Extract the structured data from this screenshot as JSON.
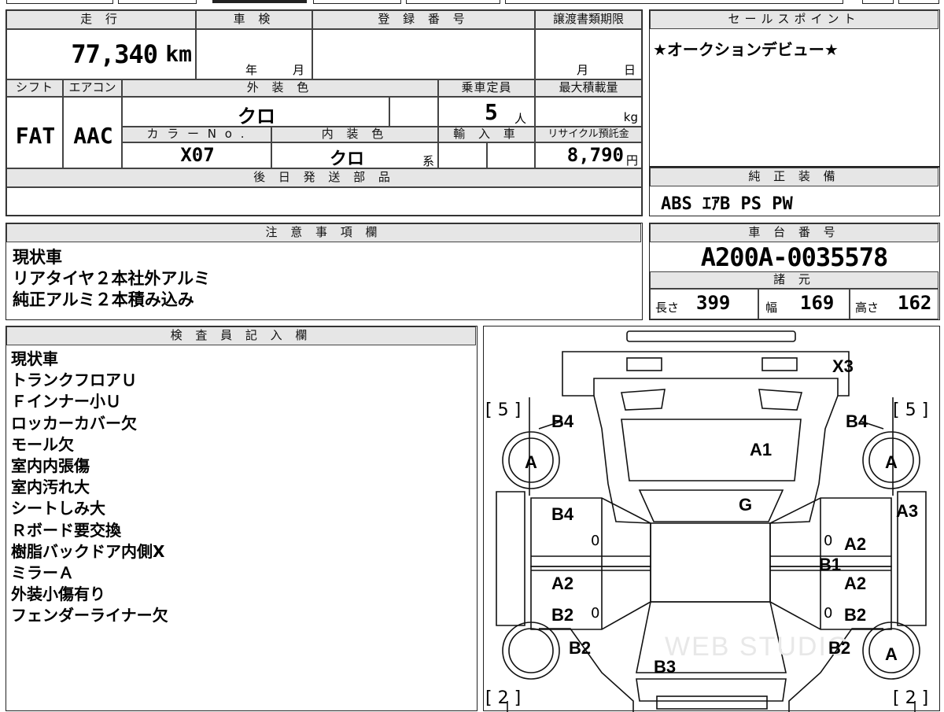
{
  "main": {
    "headers": {
      "mileage": "走 行",
      "inspection": "車 検",
      "registration": "登 録 番 号",
      "transfer_deadline": "譲渡書類期限",
      "shift": "シフト",
      "aircon": "エアコン",
      "exterior_color": "外 装 色",
      "capacity": "乗車定員",
      "max_load": "最大積載量",
      "color_no": "カ ラ ー N o .",
      "interior_color": "内 装 色",
      "import": "輸 入 車",
      "recycle": "リサイクル預託金",
      "later_parts": "後 日 発 送 部 品"
    },
    "mileage_value": "77,340",
    "mileage_unit": "km",
    "inspection_year_label": "年",
    "inspection_month_label": "月",
    "deadline_month_label": "月",
    "deadline_day_label": "日",
    "shift_value": "FAT",
    "aircon_value": "AAC",
    "exterior_color_value": "クロ",
    "capacity_value": "5",
    "capacity_unit": "人",
    "max_load_unit": "kg",
    "color_no_value": "X07",
    "interior_color_value": "クロ",
    "interior_suffix": "系",
    "recycle_value": "8,790",
    "recycle_unit": "円"
  },
  "sales": {
    "header": "セールスポイント",
    "text": "★オークションデビュー★"
  },
  "equipment": {
    "header": "純 正 装 備",
    "text": "ABS ｴｱB PS PW"
  },
  "notes": {
    "header": "注 意 事 項 欄",
    "lines": [
      "現状車",
      "リアタイヤ２本社外アルミ",
      "純正アルミ２本積み込み"
    ]
  },
  "chassis": {
    "header": "車 台 番 号",
    "value": "A200A-0035578",
    "spec_header": "諸 元",
    "length_label": "長さ",
    "length_value": "399",
    "width_label": "幅",
    "width_value": "169",
    "height_label": "高さ",
    "height_value": "162"
  },
  "inspector": {
    "header": "検 査 員 記 入 欄",
    "lines": [
      "現状車",
      "トランクフロアＵ",
      "Ｆインナー小Ｕ",
      "ロッカーカバー欠",
      "モール欠",
      "室内内張傷",
      "室内汚れ大",
      "シートしみ大",
      "Ｒボード要交換",
      "樹脂バックドア内側X",
      "ミラーＡ",
      "外装小傷有り",
      "フェンダーライナー欠"
    ]
  },
  "diagram": {
    "watermark": "WEB STUDIO",
    "tire_tread_front_left": "[ 5 ]",
    "tire_tread_front_right": "[ 5 ]",
    "tire_tread_rear_left": "[ 2 ]",
    "tire_tread_rear_right": "[ 2 ]",
    "marks": {
      "x3": "X3",
      "b4_left": "B4",
      "b4_right": "B4",
      "a_front_left": "A",
      "a_front_right": "A",
      "a1": "A1",
      "g": "G",
      "b4_door": "B4",
      "a3": "A3",
      "a2_right_front": "A2",
      "b1": "B1",
      "a2_left": "A2",
      "a2_right_rear": "A2",
      "b2_left_door": "B2",
      "b2_right_door": "B2",
      "b2_left_rear": "B2",
      "b2_right_rear": "B2",
      "a_rear_right": "A",
      "b3": "B3",
      "zero_1": "0",
      "zero_2": "0",
      "zero_3": "0",
      "zero_4": "0"
    }
  }
}
